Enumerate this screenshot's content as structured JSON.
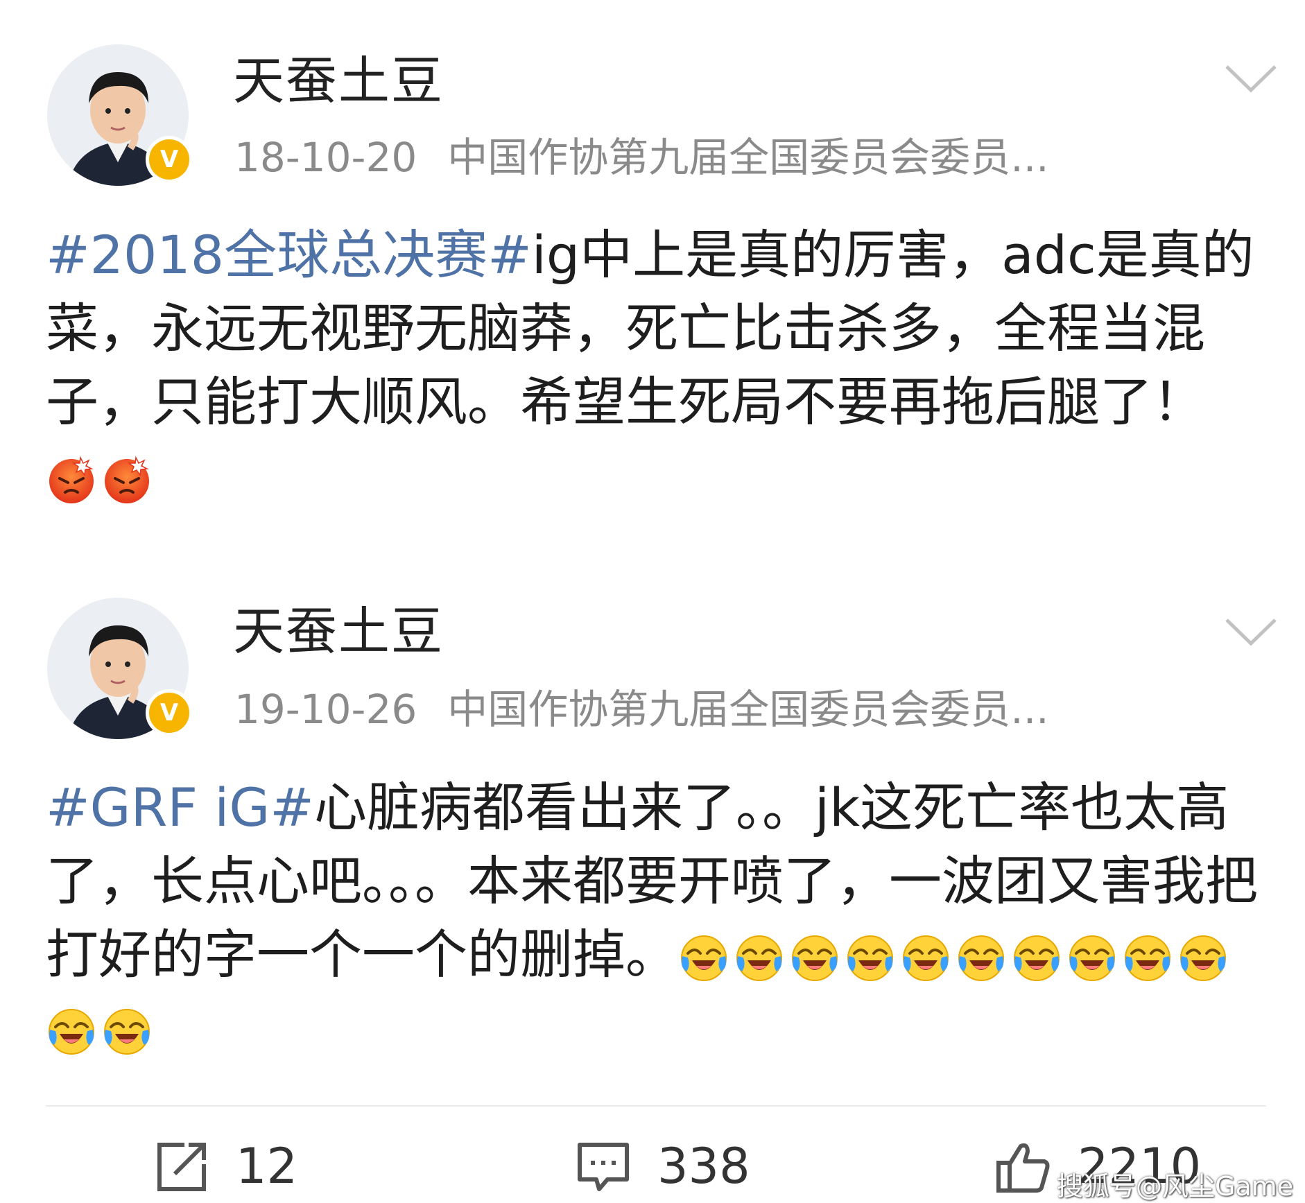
{
  "colors": {
    "hashtag": "#4f73a6",
    "meta_text": "#8a8a8a",
    "verified_badge": "#f7b500",
    "divider": "#ececec"
  },
  "posts": [
    {
      "username": "天蚕土豆",
      "date": "18-10-20",
      "description": "中国作协第九届全国委员会委员...",
      "verified_mark": "V",
      "hashtag": "#2018全球总决赛#",
      "text": "ig中上是真的厉害，adc是真的菜，永远无视野无脑莽，死亡比击杀多，全程当混子，只能打大顺风。希望生死局不要再拖后腿了！",
      "emojis": [
        "angry-face-icon",
        "angry-face-icon"
      ]
    },
    {
      "username": "天蚕土豆",
      "date": "19-10-26",
      "description": "中国作协第九届全国委员会委员...",
      "verified_mark": "V",
      "hashtag": "#GRF iG#",
      "text": "心脏病都看出来了。。jk这死亡率也太高了，长点心吧。。。本来都要开喷了，一波团又害我把打好的字一个一个的删掉。",
      "emojis": [
        "crying-laughing-icon",
        "crying-laughing-icon",
        "crying-laughing-icon",
        "crying-laughing-icon",
        "crying-laughing-icon",
        "crying-laughing-icon",
        "crying-laughing-icon",
        "crying-laughing-icon",
        "crying-laughing-icon",
        "crying-laughing-icon",
        "crying-laughing-icon",
        "crying-laughing-icon"
      ]
    }
  ],
  "actions": {
    "repost_count": "12",
    "comment_count": "338",
    "like_count": "2210"
  },
  "watermark": "搜狐号@风尘Game"
}
